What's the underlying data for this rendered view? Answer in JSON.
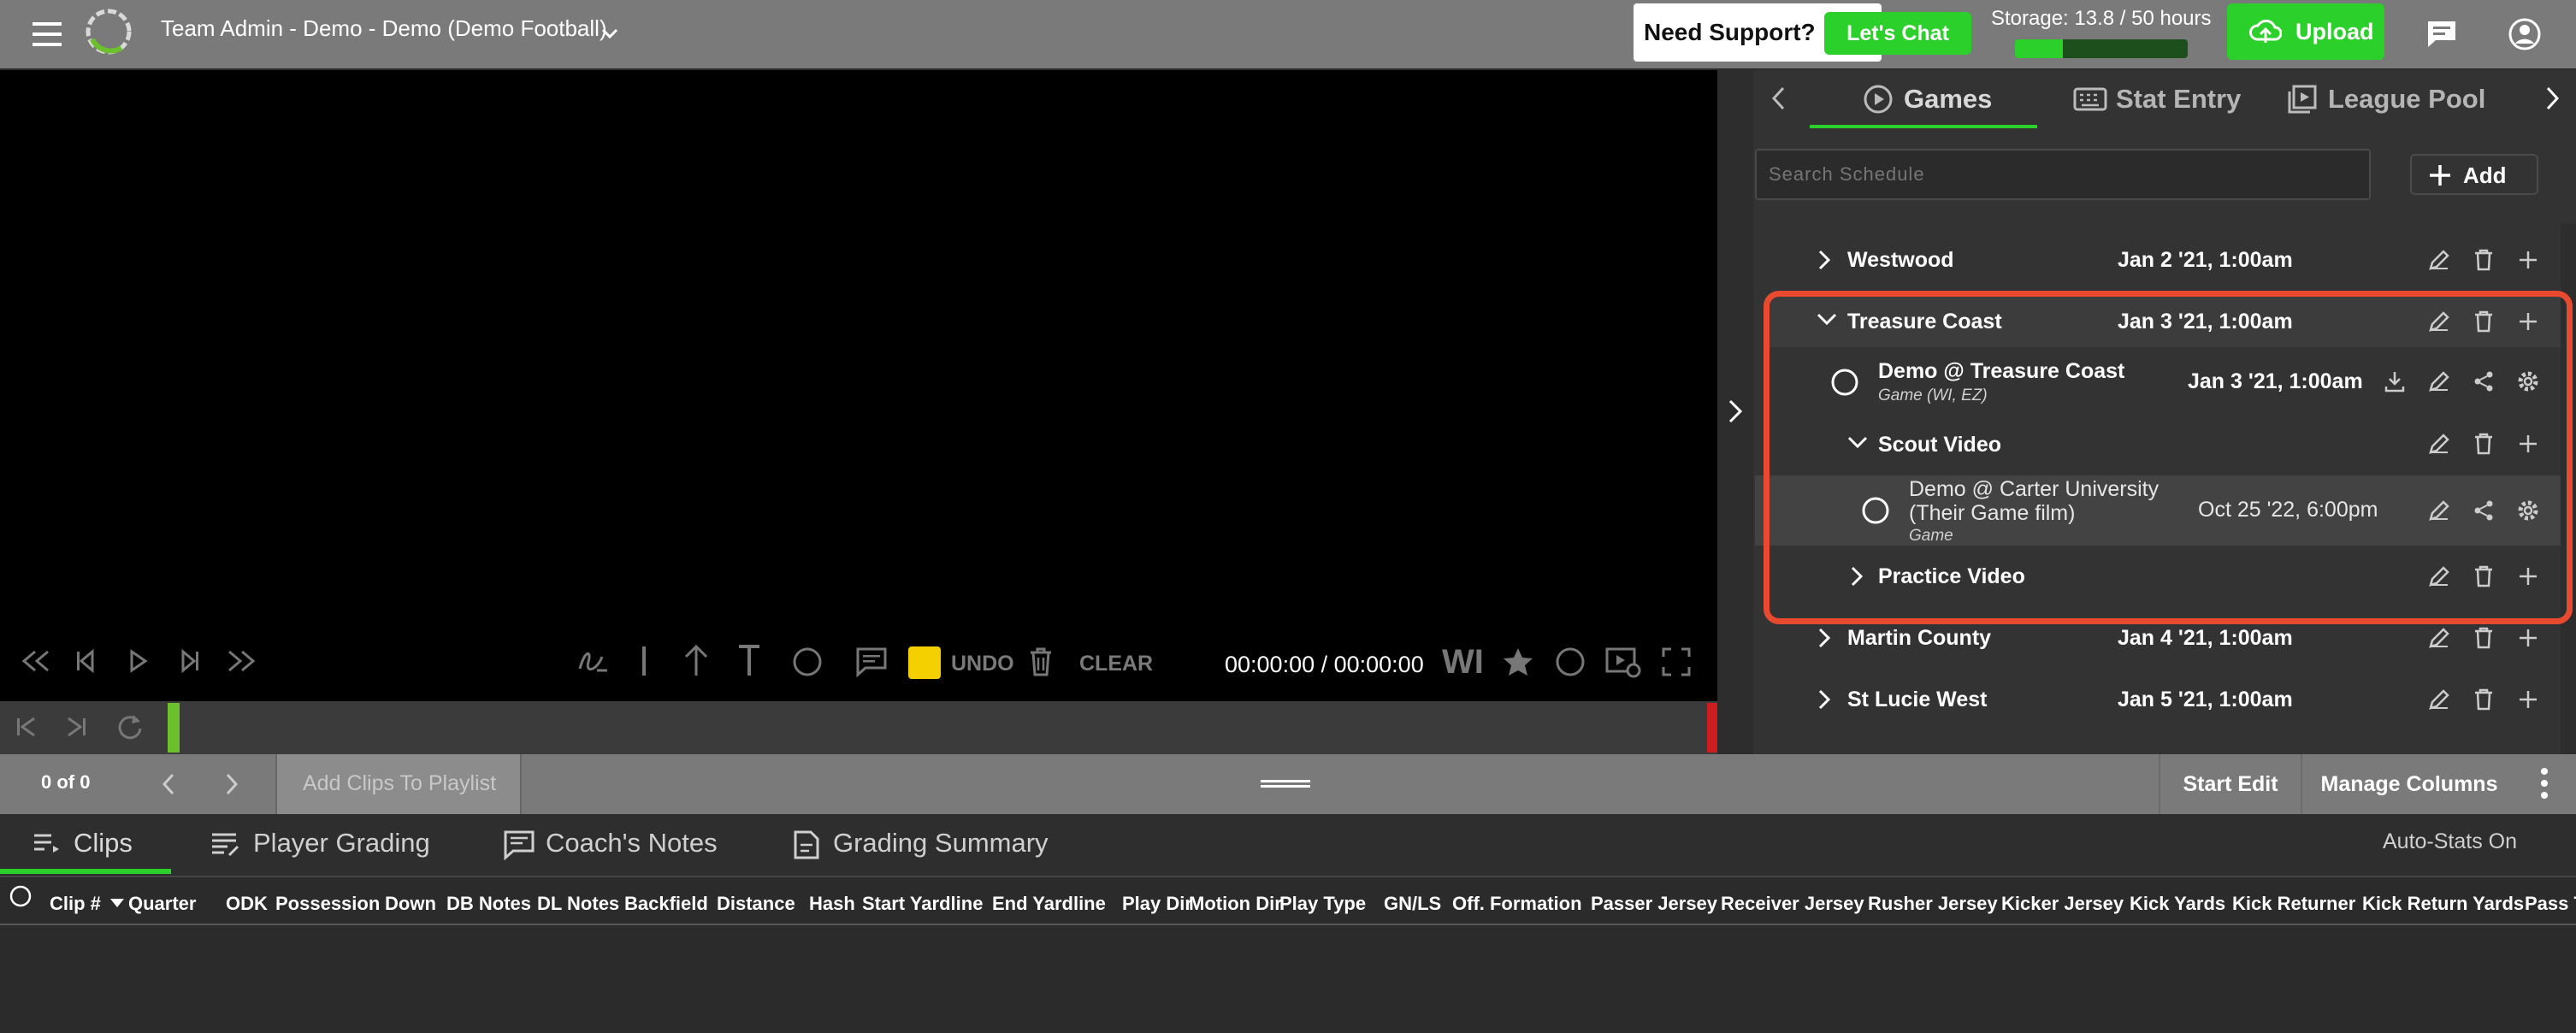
{
  "header": {
    "team_title": "Team Admin - Demo - Demo (Demo Football)",
    "support_text": "Need Support?",
    "chat_label": "Let's Chat",
    "storage_text": "Storage: 13.8 / 50 hours",
    "storage_fraction": 0.276,
    "upload_label": "Upload"
  },
  "colors": {
    "accent_green": "#2bd02b",
    "header_gray": "#7a7a7a",
    "highlight_red": "#e84a2f"
  },
  "player": {
    "undo_label": "UNDO",
    "clear_label": "CLEAR",
    "timecode": "00:00:00 / 00:00:00",
    "wi_label": "WI"
  },
  "panel": {
    "tabs": [
      {
        "label": "Games"
      },
      {
        "label": "Stat Entry"
      },
      {
        "label": "League Pool"
      }
    ],
    "search_placeholder": "Search Schedule",
    "add_label": "Add",
    "rows": [
      {
        "name": "Westwood",
        "date": "Jan 2 '21, 1:00am"
      },
      {
        "name": "Treasure Coast",
        "date": "Jan 3 '21, 1:00am"
      },
      {
        "name": "Demo @ Treasure Coast",
        "sub": "Game (WI, EZ)",
        "date": "Jan 3 '21, 1:00am"
      },
      {
        "name": "Scout Video"
      },
      {
        "name": "Demo @ Carter University",
        "name2": "(Their Game film)",
        "sub": "Game",
        "date": "Oct 25 '22, 6:00pm"
      },
      {
        "name": "Practice Video"
      },
      {
        "name": "Martin County",
        "date": "Jan 4 '21, 1:00am"
      },
      {
        "name": "St Lucie West",
        "date": "Jan 5 '21, 1:00am"
      }
    ]
  },
  "midbar": {
    "count": "0 of 0",
    "add_clips": "Add Clips To Playlist",
    "start_edit": "Start Edit",
    "manage_columns": "Manage Columns"
  },
  "bottom_tabs": [
    {
      "label": "Clips"
    },
    {
      "label": "Player Grading"
    },
    {
      "label": "Coach's Notes"
    },
    {
      "label": "Grading Summary"
    }
  ],
  "auto_stats": "Auto-Stats On",
  "columns": [
    "Clip #",
    "Quarter",
    "ODK",
    "Possession",
    "Down",
    "DB Notes",
    "DL Notes",
    "Backfield",
    "Distance",
    "Hash",
    "Start Yardline",
    "End Yardline",
    "Play Dir",
    "Motion Dir",
    "Play Type",
    "GN/LS",
    "Off. Formation",
    "Passer Jersey",
    "Receiver Jersey",
    "Rusher Jersey",
    "Kicker Jersey",
    "Kick Yards",
    "Kick Returner",
    "Kick Return Yards",
    "Pass T"
  ]
}
